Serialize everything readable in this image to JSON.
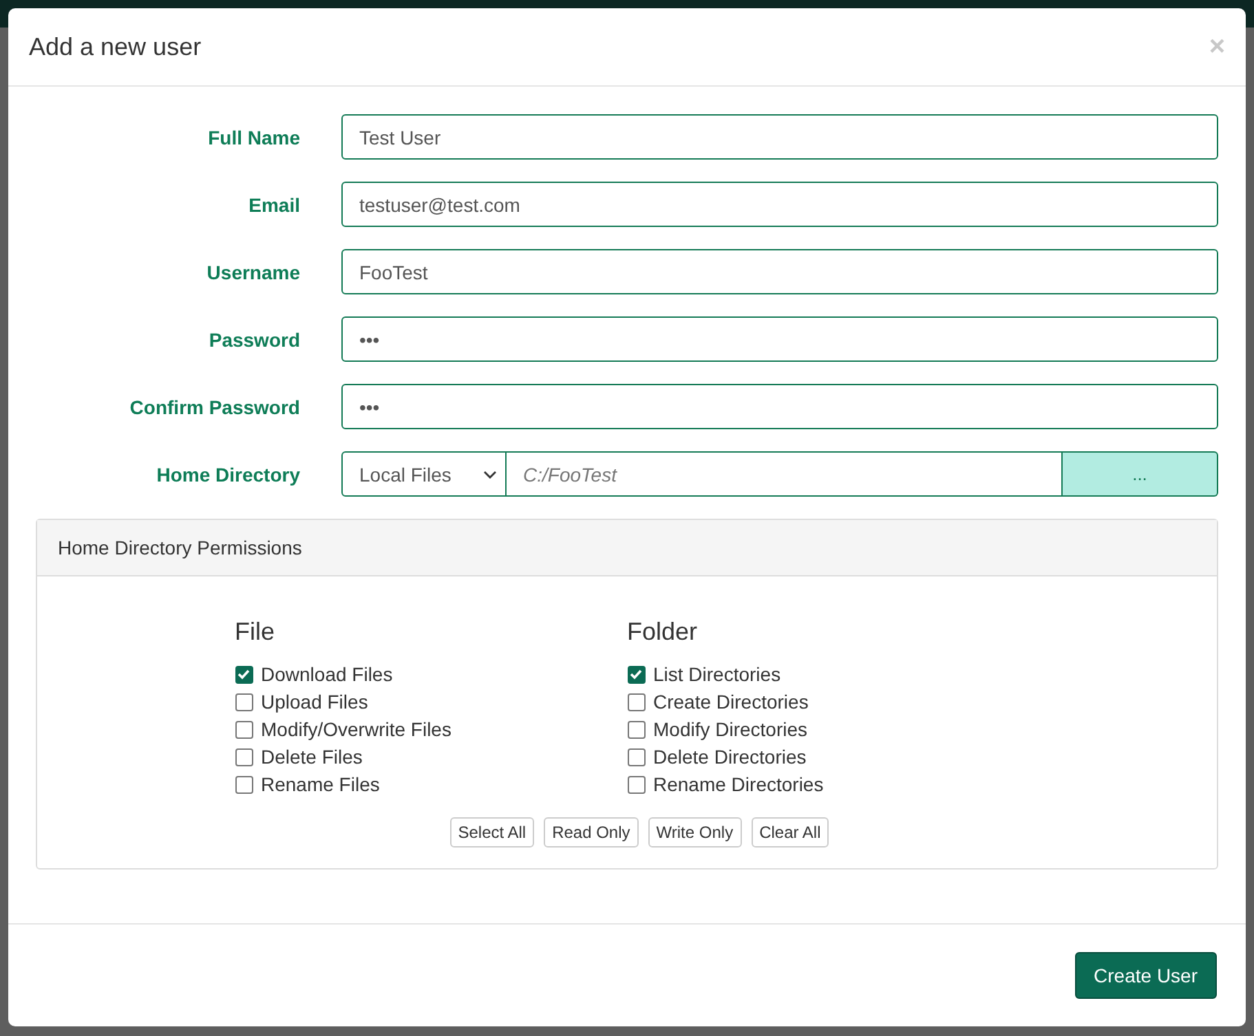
{
  "dialog": {
    "title": "Add a new user",
    "close": "×"
  },
  "fields": [
    {
      "label": "Full Name",
      "kind": "text",
      "value": "Test User"
    },
    {
      "label": "Email",
      "kind": "text",
      "value": "testuser@test.com"
    },
    {
      "label": "Username",
      "kind": "text",
      "value": "FooTest"
    },
    {
      "label": "Password",
      "kind": "text",
      "value": "•••"
    },
    {
      "label": "Confirm Password",
      "kind": "text",
      "value": "•••"
    },
    {
      "label": "Home Directory",
      "kind": "directory",
      "source": "Local Files",
      "placeholder": "C:/FooTest",
      "browse": "..."
    }
  ],
  "permissions": {
    "title": "Home Directory Permissions",
    "groups": [
      {
        "title": "File",
        "items": [
          {
            "label": "Download Files",
            "checked": true
          },
          {
            "label": "Upload Files",
            "checked": false
          },
          {
            "label": "Modify/Overwrite Files",
            "checked": false
          },
          {
            "label": "Delete Files",
            "checked": false
          },
          {
            "label": "Rename Files",
            "checked": false
          }
        ]
      },
      {
        "title": "Folder",
        "items": [
          {
            "label": "List Directories",
            "checked": true
          },
          {
            "label": "Create Directories",
            "checked": false
          },
          {
            "label": "Modify Directories",
            "checked": false
          },
          {
            "label": "Delete Directories",
            "checked": false
          },
          {
            "label": "Rename Directories",
            "checked": false
          }
        ]
      }
    ],
    "buttons": [
      "Select All",
      "Read Only",
      "Write Only",
      "Clear All"
    ]
  },
  "submit": "Create User"
}
